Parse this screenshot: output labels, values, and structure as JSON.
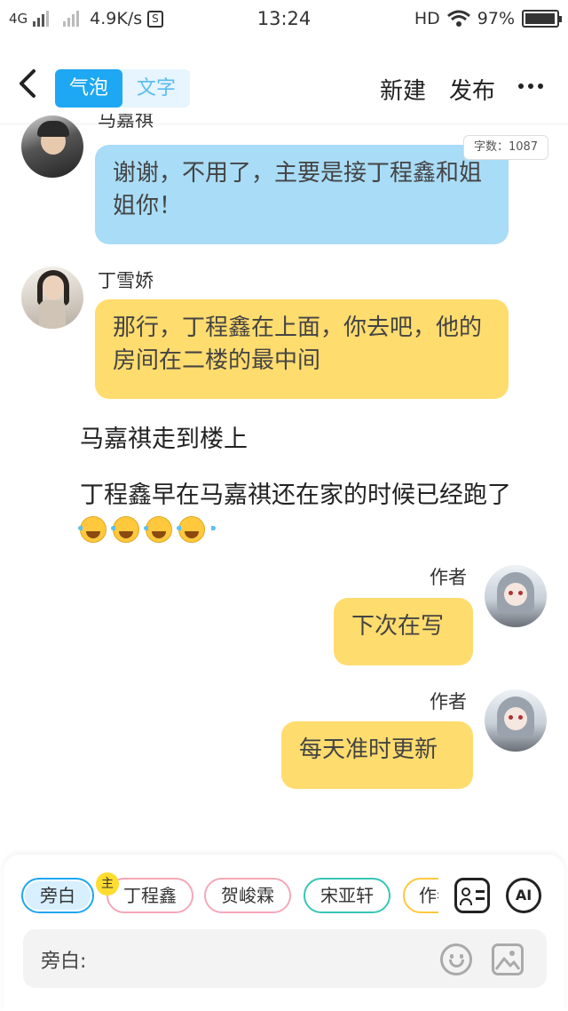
{
  "status_bar": {
    "network": "4G",
    "speed": "4.9K/s",
    "time": "13:24",
    "hd": "HD",
    "battery": "97%",
    "battery_level": 0.97
  },
  "header": {
    "tab_bubble": "气泡",
    "tab_text": "文字",
    "new_label": "新建",
    "publish_label": "发布"
  },
  "word_count": "字数：1087",
  "messages": [
    {
      "speaker": "马嘉祺",
      "text": "谢谢，不用了，主要是接丁程鑫和姐姐你！"
    },
    {
      "speaker": "丁雪娇",
      "text": "那行，丁程鑫在上面，你去吧，他的房间在二楼的最中间"
    }
  ],
  "narration": [
    {
      "text": "马嘉祺走到楼上"
    },
    {
      "text": "丁程鑫早在马嘉祺还在家的时候已经跑了"
    }
  ],
  "author_messages": [
    {
      "speaker": "作者",
      "text": "下次在写"
    },
    {
      "speaker": "作者",
      "text": "每天准时更新"
    }
  ],
  "characters": {
    "main_tag": "主",
    "items": [
      "旁白",
      "丁程鑫",
      "贺峻霖",
      "宋亚轩",
      "作者"
    ]
  },
  "composer": {
    "label": "旁白:",
    "ai_label": "AI"
  },
  "colors": {
    "accent": "#1ea7f2",
    "bubble_blue": "#a9dcf6",
    "bubble_yellow": "#ffdc6e"
  }
}
